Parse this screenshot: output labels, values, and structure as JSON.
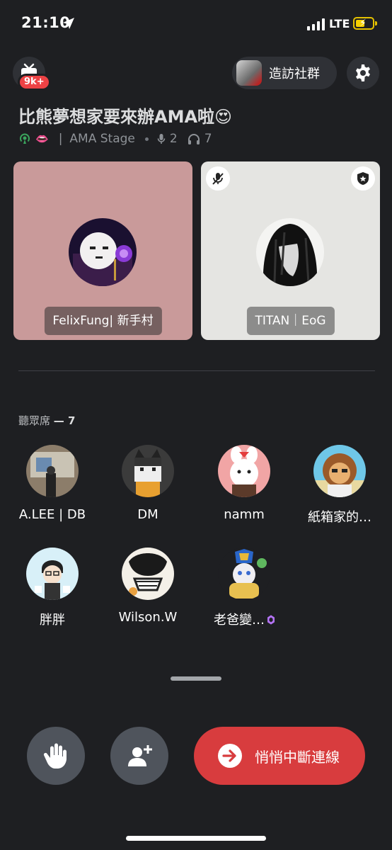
{
  "status_bar": {
    "time": "21:10",
    "network": "LTE"
  },
  "header": {
    "notification_count": "9k+",
    "visit_label": "造訪社群"
  },
  "stage": {
    "title": "比熊夢想家要來辦AMA啦😍",
    "category": "AMA Stage",
    "speaker_count": "2",
    "listener_count": "7"
  },
  "speakers": [
    {
      "name": "FelixFung| 新手村",
      "muted": false,
      "moderator": false,
      "card_color": "#c99a9a"
    },
    {
      "name": "TITAN｜EoG",
      "muted": true,
      "moderator": true,
      "card_color": "#e5e5e2"
    }
  ],
  "audience": {
    "label": "聽眾席",
    "count": "7",
    "listeners": [
      {
        "name": "A.LEE | DB"
      },
      {
        "name": "DM"
      },
      {
        "name": "namm"
      },
      {
        "name": "紙箱家的…"
      },
      {
        "name": "胖胖"
      },
      {
        "name": "Wilson.W"
      },
      {
        "name": "老爸變…",
        "boost_badge": true
      }
    ]
  },
  "actions": {
    "leave_label": "悄悄中斷連線"
  },
  "colors": {
    "background": "#1e1f22",
    "leave": "#d83c3e",
    "button": "#4f545c",
    "boost": "#b473f5"
  }
}
